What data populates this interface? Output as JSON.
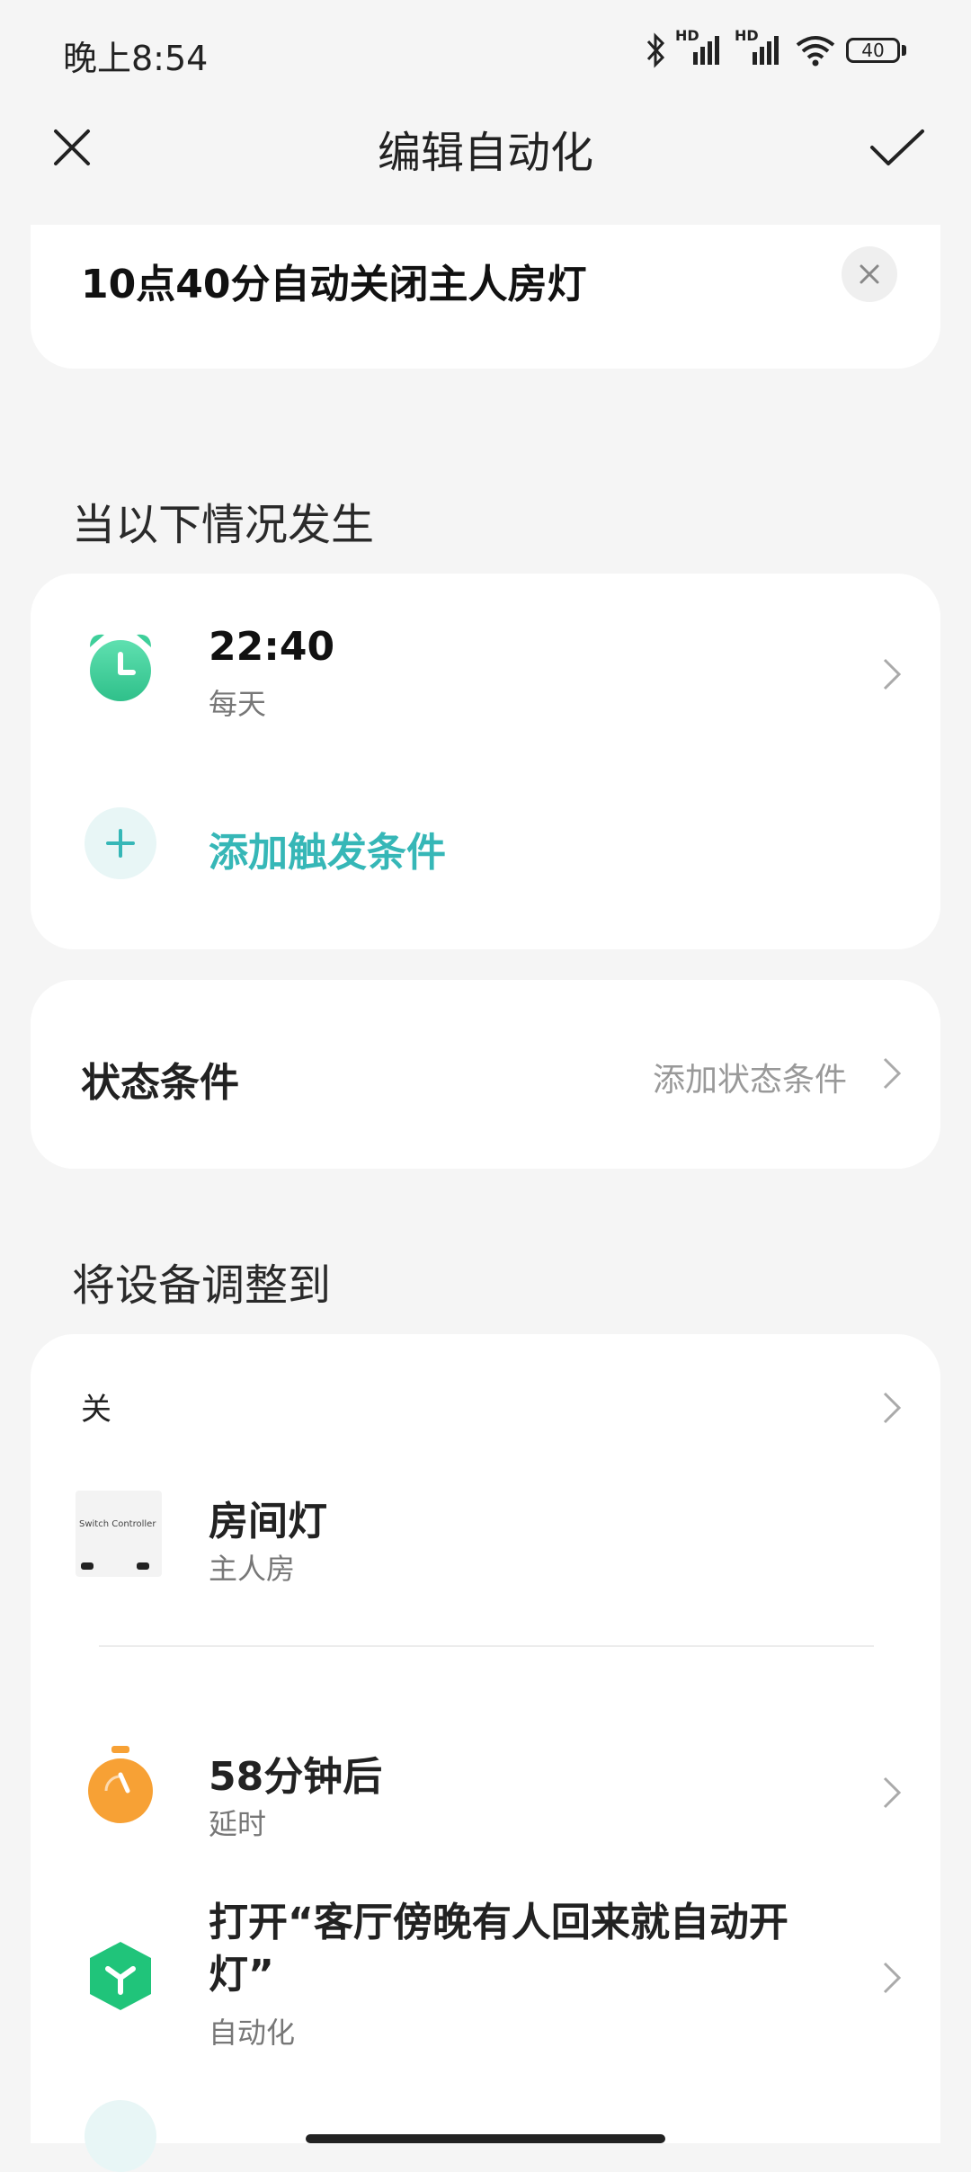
{
  "status_bar": {
    "time": "晚上8:54",
    "hd1": "HD",
    "hd2": "HD",
    "battery": "40"
  },
  "header": {
    "title": "编辑自动化"
  },
  "name_card": {
    "name_value": "10点40分自动关闭主人房灯"
  },
  "triggers": {
    "section_title": "当以下情况发生",
    "items": [
      {
        "title": "22:40",
        "subtitle": "每天",
        "icon": "alarm-clock-icon"
      }
    ],
    "add_label": "添加触发条件"
  },
  "conditions": {
    "label": "状态条件",
    "action_label": "添加状态条件"
  },
  "actions": {
    "section_title": "将设备调整到",
    "device_action": {
      "state": "关",
      "device_name": "房间灯",
      "device_room": "主人房",
      "device_image_text": "Switch Controller"
    },
    "delay": {
      "title": "58分钟后",
      "subtitle": "延时",
      "icon": "stopwatch-icon"
    },
    "automation": {
      "title": "打开“客厅傍晚有人回来就自动开灯”",
      "subtitle": "自动化",
      "icon": "automation-hexagon-icon"
    }
  },
  "colors": {
    "accent": "#36b7b7",
    "alarm_green": "#3ecf9a",
    "timer_orange": "#f7a135",
    "automation_green": "#20c47a",
    "background": "#f5f5f5"
  }
}
